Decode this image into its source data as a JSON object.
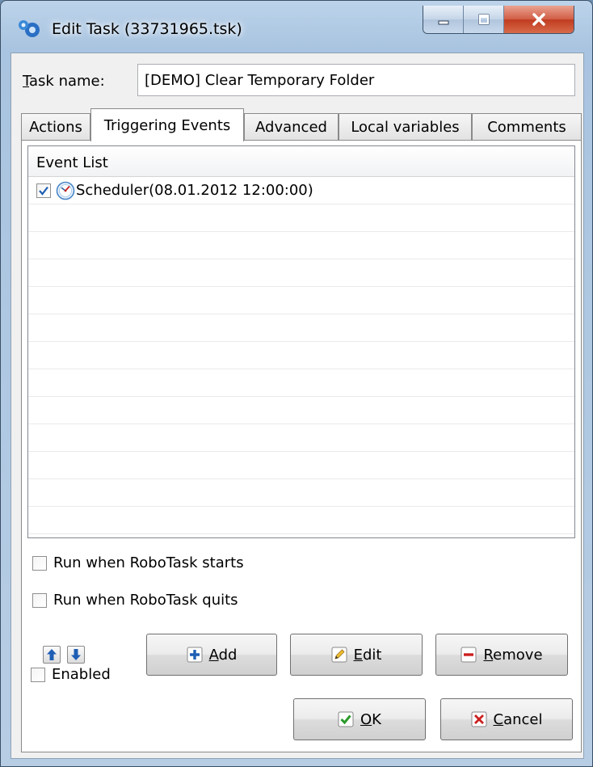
{
  "window": {
    "title": "Edit Task (33731965.tsk)"
  },
  "task": {
    "label_first": "T",
    "label_rest": "ask name:",
    "value": "[DEMO] Clear Temporary Folder"
  },
  "tabs": [
    {
      "label": "Actions"
    },
    {
      "label": "Triggering Events"
    },
    {
      "label": "Advanced"
    },
    {
      "label": "Local variables"
    },
    {
      "label": "Comments"
    }
  ],
  "event_list": {
    "header": "Event List",
    "rows": [
      {
        "text": "Scheduler(08.01.2012 12:00:00)",
        "checked": true
      }
    ]
  },
  "options": {
    "run_on_start": "Run when RoboTask starts",
    "run_on_quit": "Run when RoboTask quits",
    "enabled": "Enabled"
  },
  "buttons": {
    "add_first": "A",
    "add_rest": "dd",
    "edit_first": "E",
    "edit_rest": "dit",
    "remove_first": "R",
    "remove_rest": "emove",
    "ok_first": "O",
    "ok_rest": "K",
    "cancel_first": "C",
    "cancel_rest": "ancel"
  },
  "icons": {
    "app": "robotask-app-icon",
    "scheduler": "clock-icon",
    "up": "arrow-up-icon",
    "down": "arrow-down-icon",
    "add": "plus-icon",
    "edit": "pencil-icon",
    "remove": "minus-icon",
    "ok": "checkmark-icon",
    "cancel": "x-icon"
  },
  "colors": {
    "accent_blue": "#1e5fb4",
    "ok_green": "#2a9a2a",
    "cancel_red": "#cc2020",
    "close_red": "#c8432a"
  }
}
